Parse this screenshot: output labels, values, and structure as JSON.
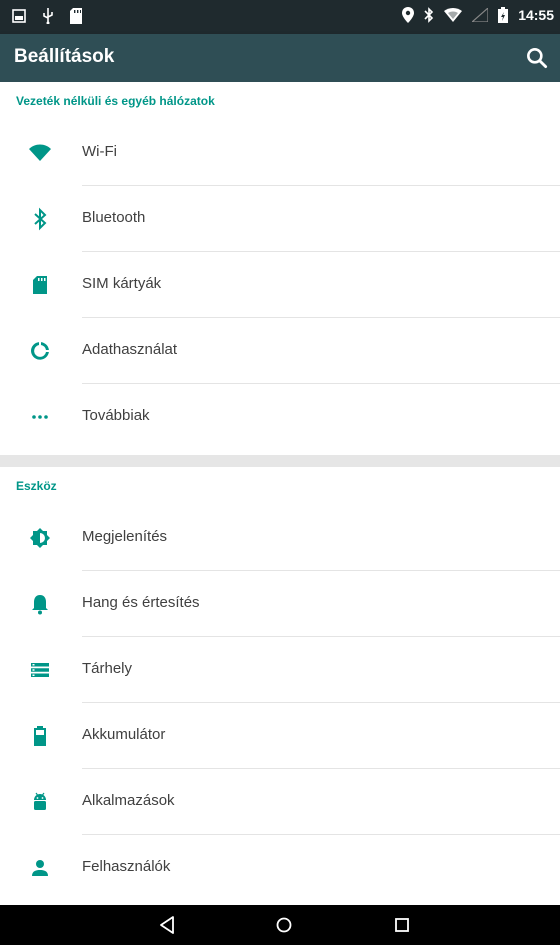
{
  "status_bar": {
    "time": "14:55",
    "left_icons": [
      "gallery-icon",
      "usb-icon",
      "sd-card-icon"
    ],
    "right_icons": [
      "location-icon",
      "bluetooth-icon",
      "wifi-icon",
      "signal-icon",
      "battery-icon"
    ]
  },
  "app_bar": {
    "title": "Beállítások",
    "search_icon": "search-icon"
  },
  "sections": [
    {
      "header": "Vezeték nélküli és egyéb hálózatok",
      "items": [
        {
          "label": "Wi-Fi",
          "icon": "wifi-icon"
        },
        {
          "label": "Bluetooth",
          "icon": "bluetooth-icon"
        },
        {
          "label": "SIM kártyák",
          "icon": "sim-card-icon"
        },
        {
          "label": "Adathasználat",
          "icon": "data-usage-icon"
        },
        {
          "label": "Továbbiak",
          "icon": "more-icon"
        }
      ]
    },
    {
      "header": "Eszköz",
      "items": [
        {
          "label": "Megjelenítés",
          "icon": "brightness-icon"
        },
        {
          "label": "Hang és értesítés",
          "icon": "bell-icon"
        },
        {
          "label": "Tárhely",
          "icon": "storage-icon"
        },
        {
          "label": "Akkumulátor",
          "icon": "battery-icon"
        },
        {
          "label": "Alkalmazások",
          "icon": "android-icon"
        },
        {
          "label": "Felhasználók",
          "icon": "person-icon"
        }
      ]
    }
  ],
  "nav_bar": {
    "buttons": [
      "back-icon",
      "home-icon",
      "recents-icon"
    ]
  },
  "colors": {
    "accent": "#009688",
    "app_bar": "#2f4e55",
    "status_bar": "#1f2a2e",
    "text": "#404040"
  }
}
